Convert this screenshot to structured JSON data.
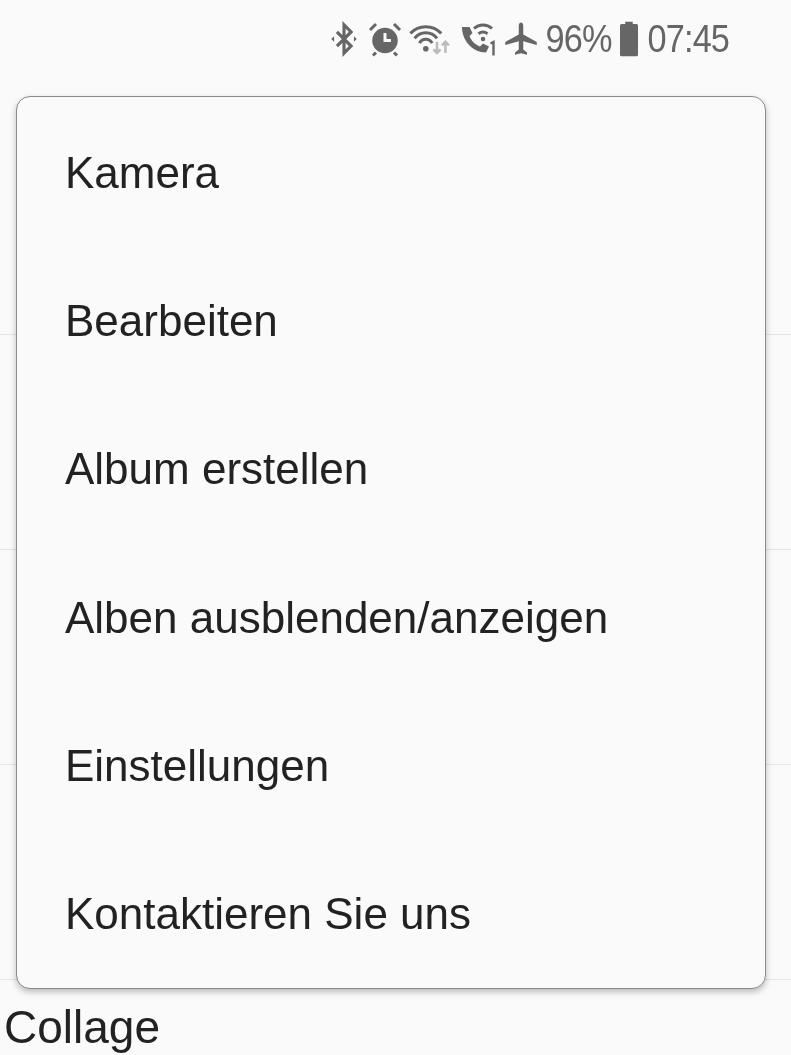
{
  "status_bar": {
    "battery": "96%",
    "time": "07:45"
  },
  "albums": [
    {
      "title": "Collage"
    }
  ],
  "menu": {
    "items": [
      {
        "label": "Kamera"
      },
      {
        "label": "Bearbeiten"
      },
      {
        "label": "Album erstellen"
      },
      {
        "label": "Alben ausblenden/anzeigen"
      },
      {
        "label": "Einstellungen"
      },
      {
        "label": "Kontaktieren Sie uns"
      }
    ]
  }
}
